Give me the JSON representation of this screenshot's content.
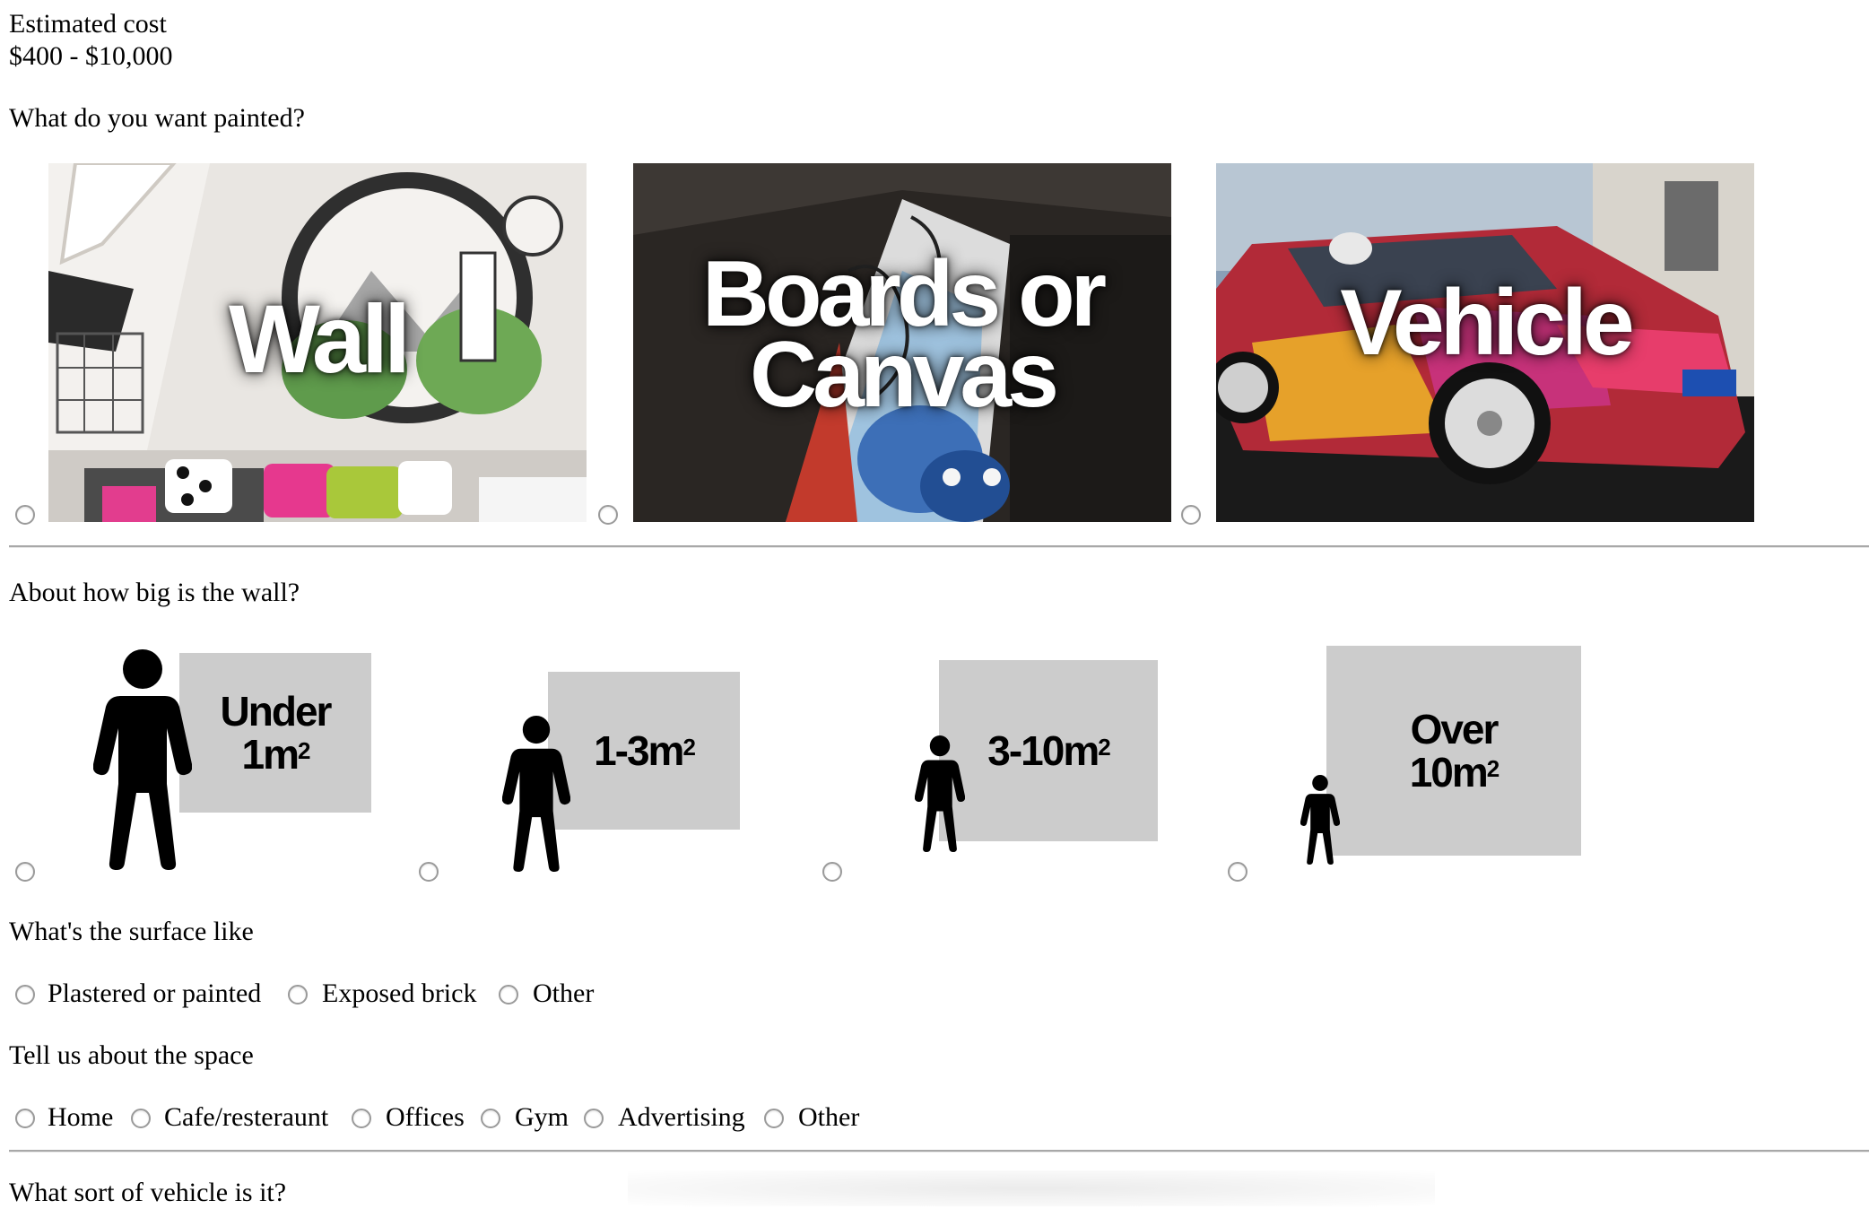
{
  "cost": {
    "label": "Estimated cost",
    "range": "$400 - $10,000"
  },
  "what_painted": {
    "question": "What do you want painted?",
    "options": [
      {
        "label": "Wall"
      },
      {
        "label_line1": "Boards or",
        "label_line2": "Canvas"
      },
      {
        "label": "Vehicle"
      }
    ]
  },
  "wall_size": {
    "question": "About how big is the wall?",
    "options": [
      {
        "line1": "Under",
        "line2": "1m",
        "sup": "2"
      },
      {
        "line1": "1-3m",
        "sup": "2"
      },
      {
        "line1": "3-10m",
        "sup": "2"
      },
      {
        "line1": "Over",
        "line2": "10m",
        "sup": "2"
      }
    ]
  },
  "surface": {
    "question": "What's the surface like",
    "options": [
      "Plastered or painted",
      "Exposed brick",
      "Other"
    ]
  },
  "space": {
    "question": "Tell us about the space",
    "options": [
      "Home",
      "Cafe/resteraunt",
      "Offices",
      "Gym",
      "Advertising",
      "Other"
    ]
  },
  "vehicle": {
    "question": "What sort of vehicle is it?"
  },
  "colors": {
    "size_box": "#cccccc",
    "divider": "#a8a8a8"
  }
}
